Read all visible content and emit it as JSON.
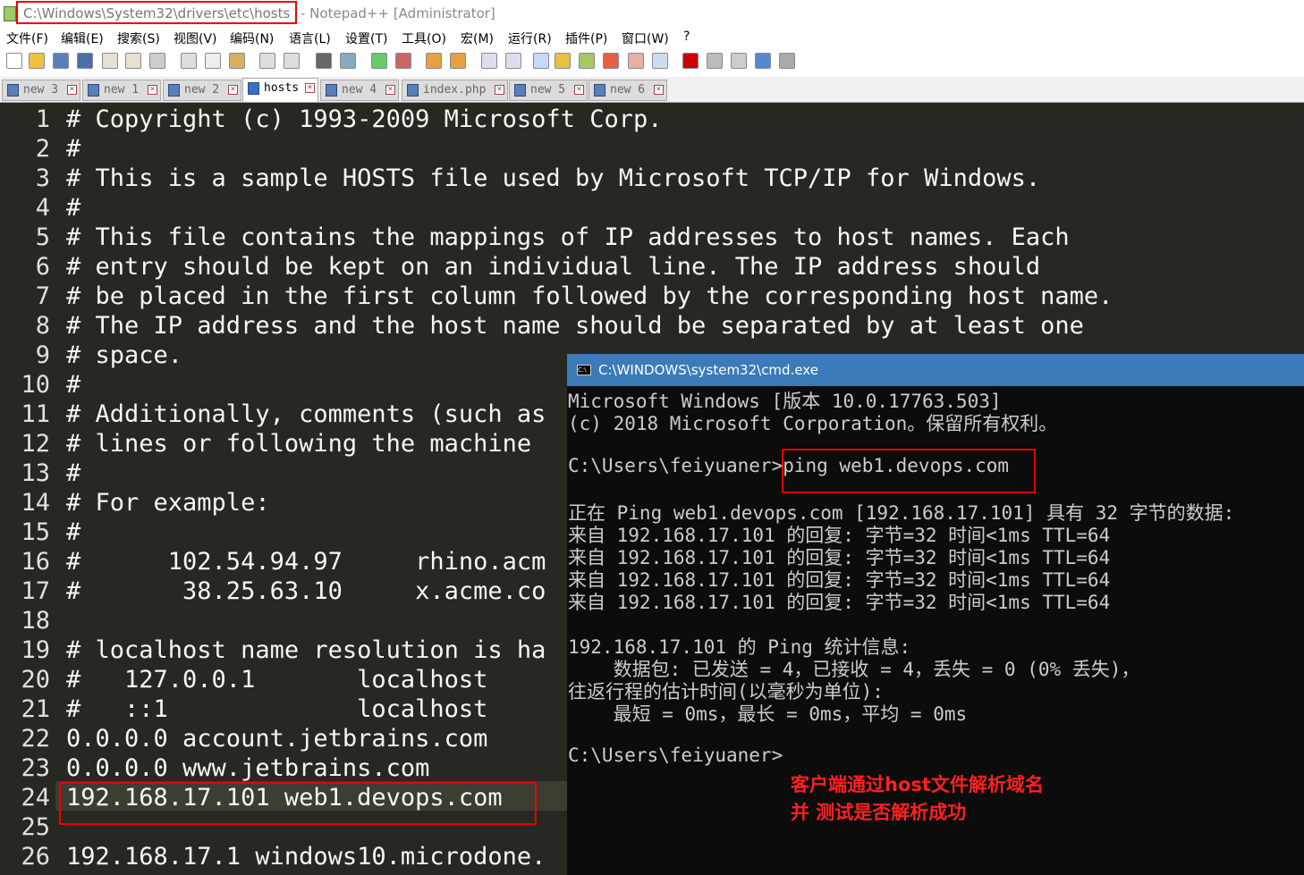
{
  "window": {
    "title_path": "C:\\Windows\\System32\\drivers\\etc\\hosts",
    "title_rest": "- Notepad++ [Administrator]"
  },
  "menu": [
    "文件(F)",
    "编辑(E)",
    "搜索(S)",
    "视图(V)",
    "编码(N)",
    "语言(L)",
    "设置(T)",
    "工具(O)",
    "宏(M)",
    "运行(R)",
    "插件(P)",
    "窗口(W)",
    "?"
  ],
  "tabs": [
    {
      "label": "new 3",
      "active": false
    },
    {
      "label": "new 1",
      "active": false
    },
    {
      "label": "new 2",
      "active": false
    },
    {
      "label": "hosts",
      "active": true
    },
    {
      "label": "new 4",
      "active": false
    },
    {
      "label": "index.php",
      "active": false
    },
    {
      "label": "new 5",
      "active": false
    },
    {
      "label": "new 6",
      "active": false
    }
  ],
  "editor": {
    "lines": [
      "# Copyright (c) 1993-2009 Microsoft Corp.",
      "#",
      "# This is a sample HOSTS file used by Microsoft TCP/IP for Windows.",
      "#",
      "# This file contains the mappings of IP addresses to host names. Each",
      "# entry should be kept on an individual line. The IP address should",
      "# be placed in the first column followed by the corresponding host name.",
      "# The IP address and the host name should be separated by at least one",
      "# space.",
      "#",
      "# Additionally, comments (such as",
      "# lines or following the machine",
      "#",
      "# For example:",
      "#",
      "#      102.54.94.97     rhino.acm",
      "#       38.25.63.10     x.acme.co",
      "",
      "# localhost name resolution is ha",
      "#   127.0.0.1       localhost",
      "#   ::1             localhost",
      "0.0.0.0 account.jetbrains.com",
      "0.0.0.0 www.jetbrains.com",
      "192.168.17.101 web1.devops.com",
      "",
      "192.168.17.1 windows10.microdone."
    ]
  },
  "cmd": {
    "title": "C:\\WINDOWS\\system32\\cmd.exe",
    "lines": [
      "Microsoft Windows [版本 10.0.17763.503]",
      "(c) 2018 Microsoft Corporation。保留所有权利。",
      "",
      "C:\\Users\\feiyuaner>ping web1.devops.com",
      "",
      "正在 Ping web1.devops.com [192.168.17.101] 具有 32 字节的数据:",
      "来自 192.168.17.101 的回复: 字节=32 时间<1ms TTL=64",
      "来自 192.168.17.101 的回复: 字节=32 时间<1ms TTL=64",
      "来自 192.168.17.101 的回复: 字节=32 时间<1ms TTL=64",
      "来自 192.168.17.101 的回复: 字节=32 时间<1ms TTL=64",
      "",
      "192.168.17.101 的 Ping 统计信息:",
      "    数据包: 已发送 = 4，已接收 = 4，丢失 = 0 (0% 丢失)，",
      "往返行程的估计时间(以毫秒为单位):",
      "    最短 = 0ms，最长 = 0ms，平均 = 0ms",
      "",
      "C:\\Users\\feiyuaner>"
    ]
  },
  "annotation": {
    "line1": "客户端通过host文件解析域名",
    "line2": "并 测试是否解析成功",
    "color": "#ff2020"
  }
}
